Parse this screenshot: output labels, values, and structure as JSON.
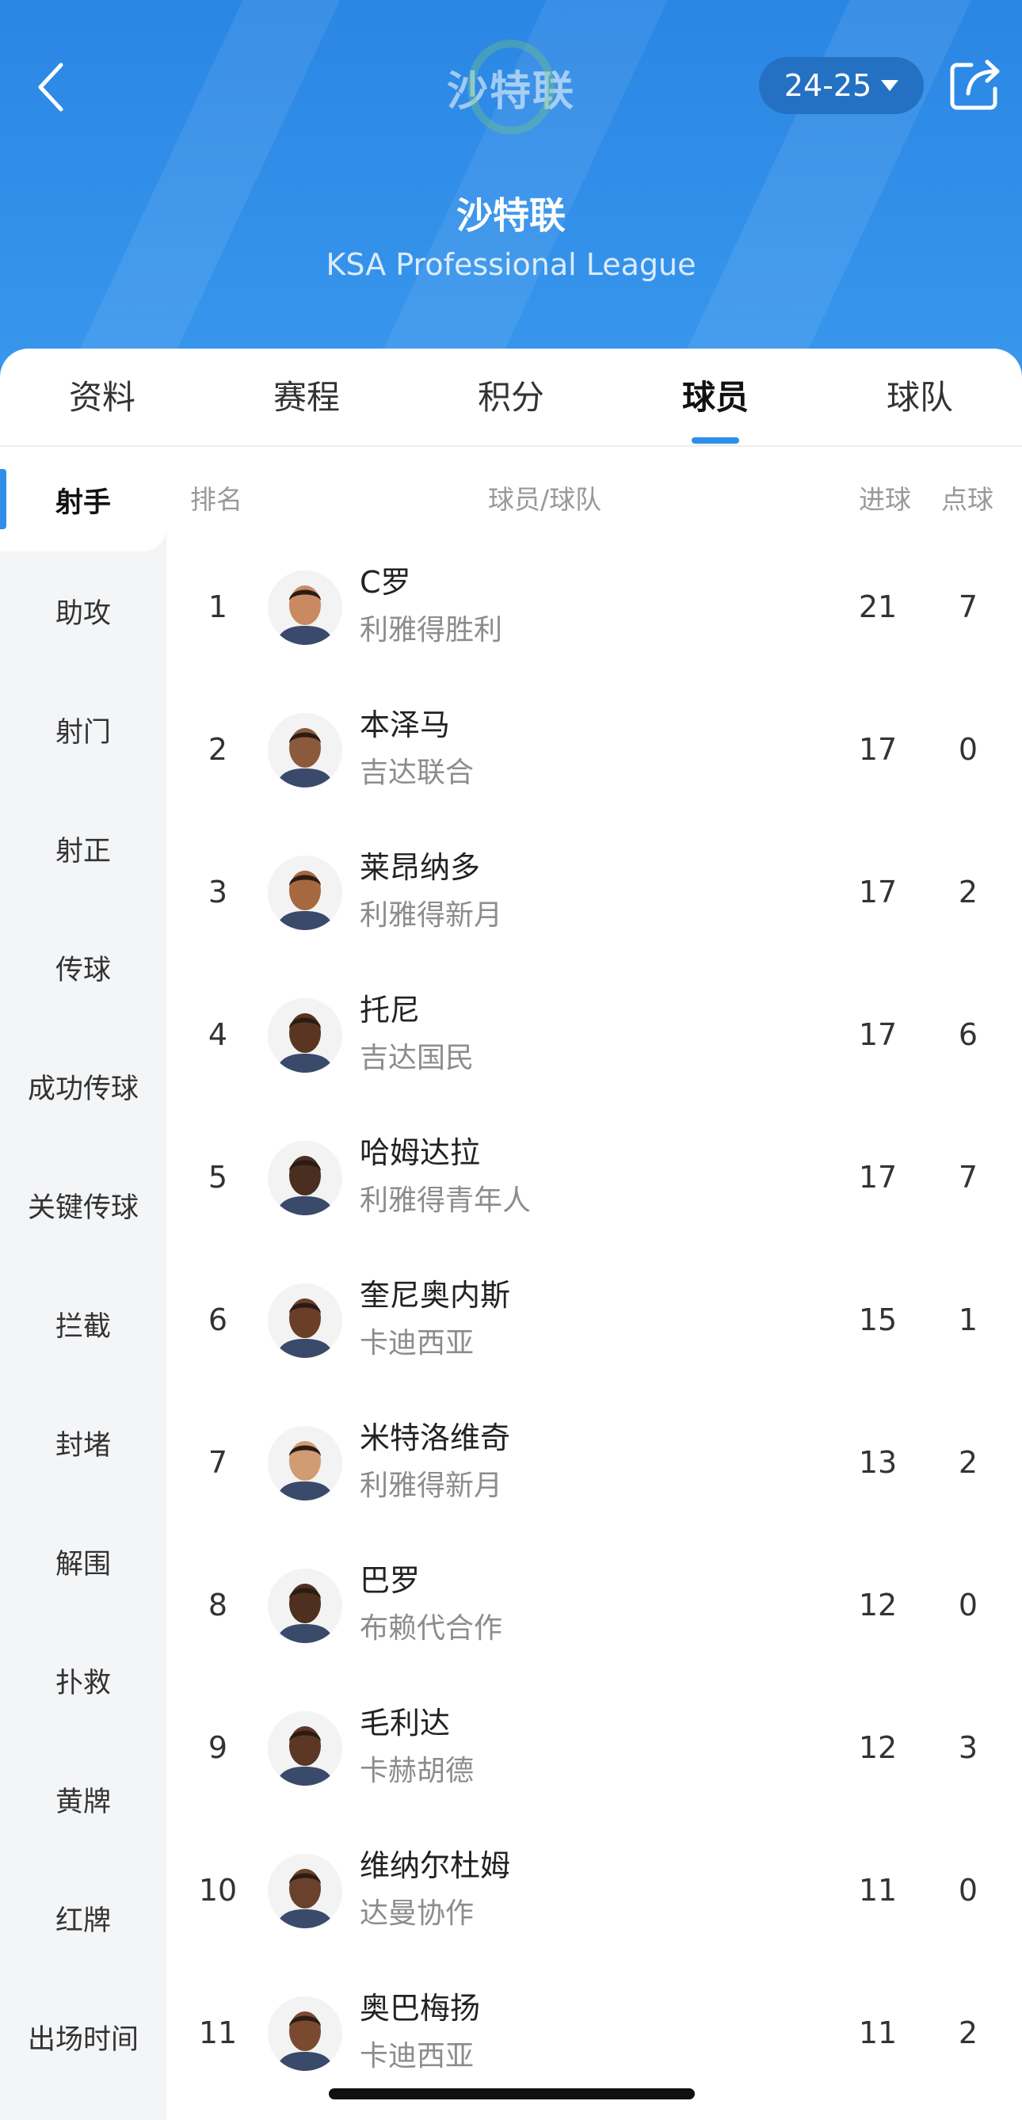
{
  "header": {
    "logo_text": "沙特联",
    "season": "24-25",
    "league_name": "沙特联",
    "league_en": "KSA Professional League"
  },
  "tabs": [
    "资料",
    "赛程",
    "积分",
    "球员",
    "球队"
  ],
  "active_tab": "球员",
  "sidebar": [
    "射手",
    "助攻",
    "射门",
    "射正",
    "传球",
    "成功传球",
    "关键传球",
    "拦截",
    "封堵",
    "解围",
    "扑救",
    "黄牌",
    "红牌",
    "出场时间"
  ],
  "table": {
    "col_rank": "排名",
    "col_player": "球员/球队",
    "col_goals": "进球",
    "col_pens": "点球",
    "rows": [
      {
        "rank": "1",
        "name": "C罗",
        "team": "利雅得胜利",
        "goals": "21",
        "pens": "7"
      },
      {
        "rank": "2",
        "name": "本泽马",
        "team": "吉达联合",
        "goals": "17",
        "pens": "0"
      },
      {
        "rank": "3",
        "name": "莱昂纳多",
        "team": "利雅得新月",
        "goals": "17",
        "pens": "2"
      },
      {
        "rank": "4",
        "name": "托尼",
        "team": "吉达国民",
        "goals": "17",
        "pens": "6"
      },
      {
        "rank": "5",
        "name": "哈姆达拉",
        "team": "利雅得青年人",
        "goals": "17",
        "pens": "7"
      },
      {
        "rank": "6",
        "name": "奎尼奥内斯",
        "team": "卡迪西亚",
        "goals": "15",
        "pens": "1"
      },
      {
        "rank": "7",
        "name": "米特洛维奇",
        "team": "利雅得新月",
        "goals": "13",
        "pens": "2"
      },
      {
        "rank": "8",
        "name": "巴罗",
        "team": "布赖代合作",
        "goals": "12",
        "pens": "0"
      },
      {
        "rank": "9",
        "name": "毛利达",
        "team": "卡赫胡德",
        "goals": "12",
        "pens": "3"
      },
      {
        "rank": "10",
        "name": "维纳尔杜姆",
        "team": "达曼协作",
        "goals": "11",
        "pens": "0"
      },
      {
        "rank": "11",
        "name": "奥巴梅扬",
        "team": "卡迪西亚",
        "goals": "11",
        "pens": "2"
      }
    ]
  },
  "colors": {
    "accent": "#2f8fe8",
    "header_bg": "#2f8fe8",
    "season_pill": "#2471c4",
    "sidebar_bg": "#f4f5f7"
  }
}
